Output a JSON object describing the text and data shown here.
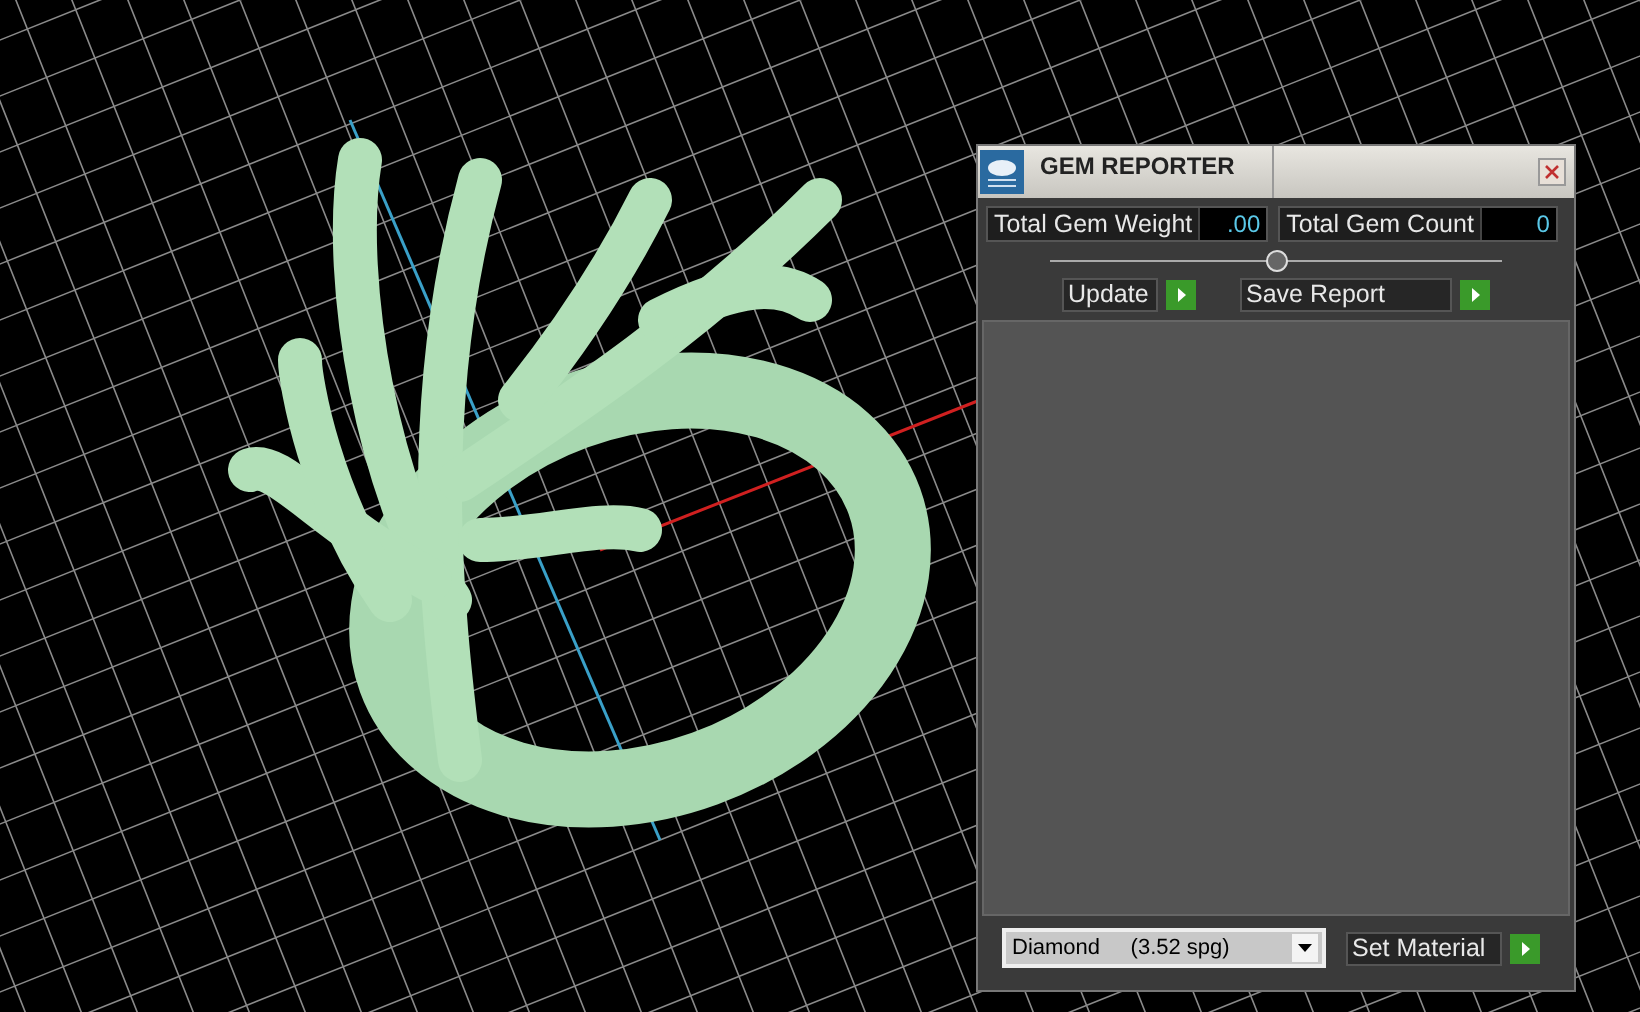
{
  "panel": {
    "title": "GEM REPORTER",
    "stats": [
      {
        "label": "Total Gem Weight",
        "value": ".00"
      },
      {
        "label": "Total Gem Count",
        "value": "0"
      }
    ],
    "slider": {
      "level": 0.5
    },
    "buttons": [
      {
        "label": "Update"
      },
      {
        "label": "Save Report"
      }
    ],
    "material": {
      "value": "Diamond     (3.52 spg)"
    },
    "set_button": {
      "label": "Set Material"
    }
  }
}
